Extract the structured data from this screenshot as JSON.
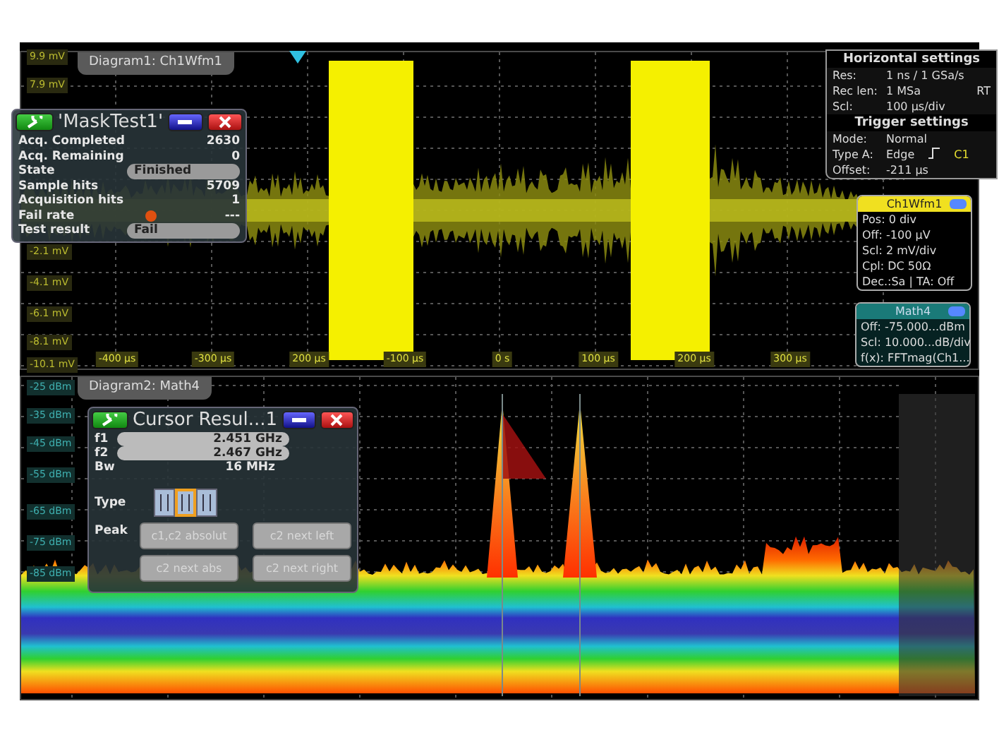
{
  "upper_diagram": {
    "title": "Diagram1: Ch1Wfm1",
    "y_labels": [
      "9.9 mV",
      "7.9 mV",
      "-2.1 mV",
      "-4.1 mV",
      "-6.1 mV",
      "-8.1 mV",
      "-10.1 mV"
    ],
    "x_labels": [
      "-400 µs",
      "-300 µs",
      "200 µs",
      "-100 µs",
      "0 s",
      "100 µs",
      "200 µs",
      "300 µs"
    ]
  },
  "mask_test": {
    "title": "'MaskTest1'",
    "rows": [
      {
        "label": "Acq. Completed",
        "value": "2630",
        "kind": "plain"
      },
      {
        "label": "Acq. Remaining",
        "value": "0",
        "kind": "plain"
      },
      {
        "label": "State",
        "value": "Finished",
        "kind": "field"
      },
      {
        "label": "Sample hits",
        "value": "5709",
        "kind": "plain"
      },
      {
        "label": "Acquisition hits",
        "value": "1",
        "kind": "plain"
      },
      {
        "label": "Fail rate",
        "value": "---",
        "kind": "alert"
      },
      {
        "label": "Test result",
        "value": "Fail",
        "kind": "field"
      }
    ]
  },
  "horizontal_settings": {
    "title": "Horizontal settings",
    "badge": "RT",
    "rows": [
      {
        "label": "Res:",
        "value": "1 ns / 1 GSa/s"
      },
      {
        "label": "Rec len:",
        "value": "1 MSa"
      },
      {
        "label": "Scl:",
        "value": "100 µs/div"
      }
    ]
  },
  "trigger_settings": {
    "title": "Trigger settings",
    "rows": [
      {
        "label": "Mode:",
        "value": "Normal"
      },
      {
        "label": "Type A:",
        "value": "Edge",
        "source": "C1"
      },
      {
        "label": "Offset:",
        "value": "-211 µs"
      }
    ]
  },
  "channel_box": {
    "title": "Ch1Wfm1",
    "lines": [
      "Pos: 0 div",
      "Off: -100 µV",
      "Scl: 2 mV/div",
      "Cpl: DC 50Ω",
      "Dec.:Sa | TA: Off"
    ]
  },
  "math_box": {
    "title": "Math4",
    "lines": [
      "Off: -75.000...dBm",
      "Scl: 10.000...dB/div",
      "f(x): FFTmag(Ch1..."
    ]
  },
  "lower_diagram": {
    "title": "Diagram2: Math4",
    "y_labels": [
      "-25 dBm",
      "-35 dBm",
      "-45 dBm",
      "-55 dBm",
      "-65 dBm",
      "-75 dBm",
      "-85 dBm"
    ]
  },
  "cursor_results": {
    "title": "Cursor Resul...1",
    "readings": [
      {
        "label": "f1",
        "value": "2.451 GHz",
        "kind": "field"
      },
      {
        "label": "f2",
        "value": "2.467 GHz",
        "kind": "field"
      },
      {
        "label": "Bw",
        "value": "16 MHz",
        "kind": "plain"
      }
    ],
    "type_label": "Type",
    "type_options": [
      {
        "selected": false
      },
      {
        "selected": true
      },
      {
        "selected": false
      }
    ],
    "peak_label": "Peak",
    "buttons": [
      {
        "label": "c1,c2 absolut",
        "disabled": true
      },
      {
        "label": "c2 next left",
        "disabled": true
      },
      {
        "label": "c2 next abs",
        "disabled": true
      },
      {
        "label": "c2 next right",
        "disabled": true
      }
    ]
  }
}
